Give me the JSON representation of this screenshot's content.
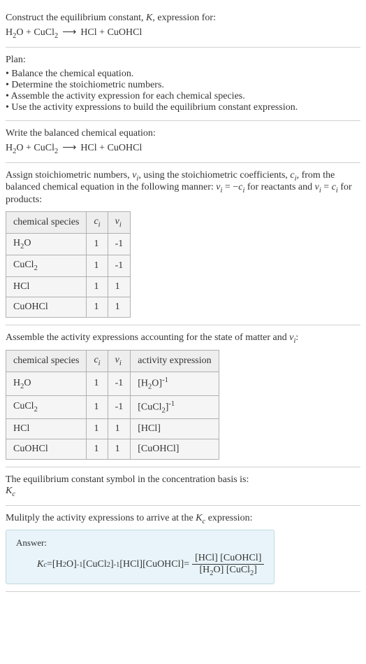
{
  "chart_data": [
    {
      "type": "table",
      "title": "Stoichiometric numbers",
      "headers": [
        "chemical species",
        "c_i",
        "ν_i"
      ],
      "rows": [
        [
          "H₂O",
          "1",
          "-1"
        ],
        [
          "CuCl₂",
          "1",
          "-1"
        ],
        [
          "HCl",
          "1",
          "1"
        ],
        [
          "CuOHCl",
          "1",
          "1"
        ]
      ]
    },
    {
      "type": "table",
      "title": "Activity expressions",
      "headers": [
        "chemical species",
        "c_i",
        "ν_i",
        "activity expression"
      ],
      "rows": [
        [
          "H₂O",
          "1",
          "-1",
          "[H₂O]⁻¹"
        ],
        [
          "CuCl₂",
          "1",
          "-1",
          "[CuCl₂]⁻¹"
        ],
        [
          "HCl",
          "1",
          "1",
          "[HCl]"
        ],
        [
          "CuOHCl",
          "1",
          "1",
          "[CuOHCl]"
        ]
      ]
    }
  ],
  "s1": {
    "prompt_a": "Construct the equilibrium constant, ",
    "prompt_k": "K",
    "prompt_b": ", expression for:",
    "eq_h2o": "H",
    "eq_h2o_sub": "2",
    "eq_h2o_o": "O",
    "plus1": " + ",
    "eq_cucl": "CuCl",
    "eq_cucl_sub": "2",
    "arrow": "⟶",
    "eq_hcl": "HCl",
    "plus2": " + ",
    "eq_cuohcl": "CuOHCl"
  },
  "s2": {
    "plan": "Plan:",
    "b1": "Balance the chemical equation.",
    "b2": "Determine the stoichiometric numbers.",
    "b3": "Assemble the activity expression for each chemical species.",
    "b4": "Use the activity expressions to build the equilibrium constant expression."
  },
  "s3": {
    "title": "Write the balanced chemical equation:"
  },
  "s4": {
    "t1": "Assign stoichiometric numbers, ",
    "nu": "ν",
    "sub_i": "i",
    "t2": ", using the stoichiometric coefficients, ",
    "c": "c",
    "t3": ", from the balanced chemical equation in the following manner: ",
    "eq1a": "ν",
    "eq1b": " = −",
    "eq1c": "c",
    "t4": " for reactants and ",
    "eq2a": "ν",
    "eq2b": " = ",
    "eq2c": "c",
    "t5": " for products:",
    "hdr1": "chemical species",
    "hdr2": "c",
    "hdr3": "ν",
    "r1a": "H",
    "r1a2": "O",
    "r1b": "1",
    "r1c": "-1",
    "r2a": "CuCl",
    "r2b": "1",
    "r2c": "-1",
    "r3a": "HCl",
    "r3b": "1",
    "r3c": "1",
    "r4a": "CuOHCl",
    "r4b": "1",
    "r4c": "1"
  },
  "s5": {
    "t1": "Assemble the activity expressions accounting for the state of matter and ",
    "nu": "ν",
    "colon": ":",
    "hdr1": "chemical species",
    "hdr2": "c",
    "hdr3": "ν",
    "hdr4": "activity expression",
    "r1_sp_a": "H",
    "r1_sp_b": "O",
    "r1_c": "1",
    "r1_n": "-1",
    "r1_ae_a": "[H",
    "r1_ae_b": "O]",
    "r1_ae_exp": "-1",
    "r2_sp": "CuCl",
    "r2_c": "1",
    "r2_n": "-1",
    "r2_ae_a": "[CuCl",
    "r2_ae_b": "]",
    "r2_ae_exp": "-1",
    "r3_sp": "HCl",
    "r3_c": "1",
    "r3_n": "1",
    "r3_ae": "[HCl]",
    "r4_sp": "CuOHCl",
    "r4_c": "1",
    "r4_n": "1",
    "r4_ae": "[CuOHCl]"
  },
  "s6": {
    "t1": "The equilibrium constant symbol in the concentration basis is:",
    "k": "K",
    "sub_c": "c"
  },
  "s7": {
    "t1": "Mulitply the activity expressions to arrive at the ",
    "k": "K",
    "sub_c": "c",
    "t2": " expression:",
    "answer_label": "Answer:",
    "kc_k": "K",
    "kc_sub": "c",
    "eq": " = ",
    "p1a": "[H",
    "p1b": "O]",
    "p1exp": "-1",
    "sp": " ",
    "p2a": "[CuCl",
    "p2b": "]",
    "p2exp": "-1",
    "p3": "[HCl]",
    "p4": "[CuOHCl]",
    "eq2": " = ",
    "num1": "[HCl] ",
    "num2": "[CuOHCl]",
    "den1a": "[H",
    "den1b": "O] ",
    "den2a": "[CuCl",
    "den2b": "]"
  },
  "common": {
    "sub2": "2",
    "sub_i": "i"
  }
}
